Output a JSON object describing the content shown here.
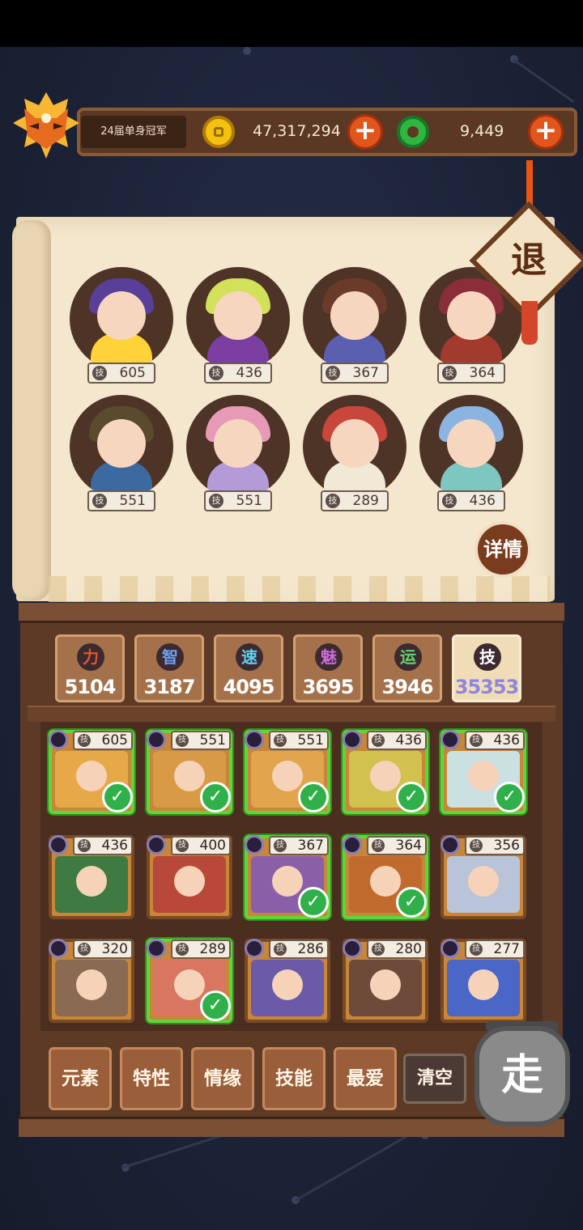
{
  "header": {
    "title_label": "24届单身冠军",
    "gold_amount": "47,317,294",
    "jade_amount": "9,449",
    "plus": "+",
    "exit_label": "退",
    "detail_label": "详情"
  },
  "team": [
    {
      "skill": "605"
    },
    {
      "skill": "436"
    },
    {
      "skill": "367"
    },
    {
      "skill": "364"
    },
    {
      "skill": "551"
    },
    {
      "skill": "551"
    },
    {
      "skill": "289"
    },
    {
      "skill": "436"
    }
  ],
  "skill_abbr": "技",
  "stats": [
    {
      "label": "力",
      "value": "5104",
      "color": "#e0572c"
    },
    {
      "label": "智",
      "value": "3187",
      "color": "#6aa0f0"
    },
    {
      "label": "速",
      "value": "4095",
      "color": "#5ed0f0"
    },
    {
      "label": "魅",
      "value": "3695",
      "color": "#c96ad6"
    },
    {
      "label": "运",
      "value": "3946",
      "color": "#5fd26a"
    },
    {
      "label": "技",
      "value": "35353",
      "color": "#ffffff"
    }
  ],
  "roster": [
    {
      "skill": "605",
      "selected": true
    },
    {
      "skill": "551",
      "selected": true
    },
    {
      "skill": "551",
      "selected": true
    },
    {
      "skill": "436",
      "selected": true
    },
    {
      "skill": "436",
      "selected": true
    },
    {
      "skill": "436",
      "selected": false
    },
    {
      "skill": "400",
      "selected": false
    },
    {
      "skill": "367",
      "selected": true
    },
    {
      "skill": "364",
      "selected": true
    },
    {
      "skill": "356",
      "selected": false
    },
    {
      "skill": "320",
      "selected": false
    },
    {
      "skill": "289",
      "selected": true
    },
    {
      "skill": "286",
      "selected": false
    },
    {
      "skill": "280",
      "selected": false
    },
    {
      "skill": "277",
      "selected": false
    }
  ],
  "check": "✓",
  "filters": [
    {
      "label": "元素"
    },
    {
      "label": "特性"
    },
    {
      "label": "情缘"
    },
    {
      "label": "技能"
    },
    {
      "label": "最爱"
    }
  ],
  "clear_label": "清空",
  "go_label": "走"
}
